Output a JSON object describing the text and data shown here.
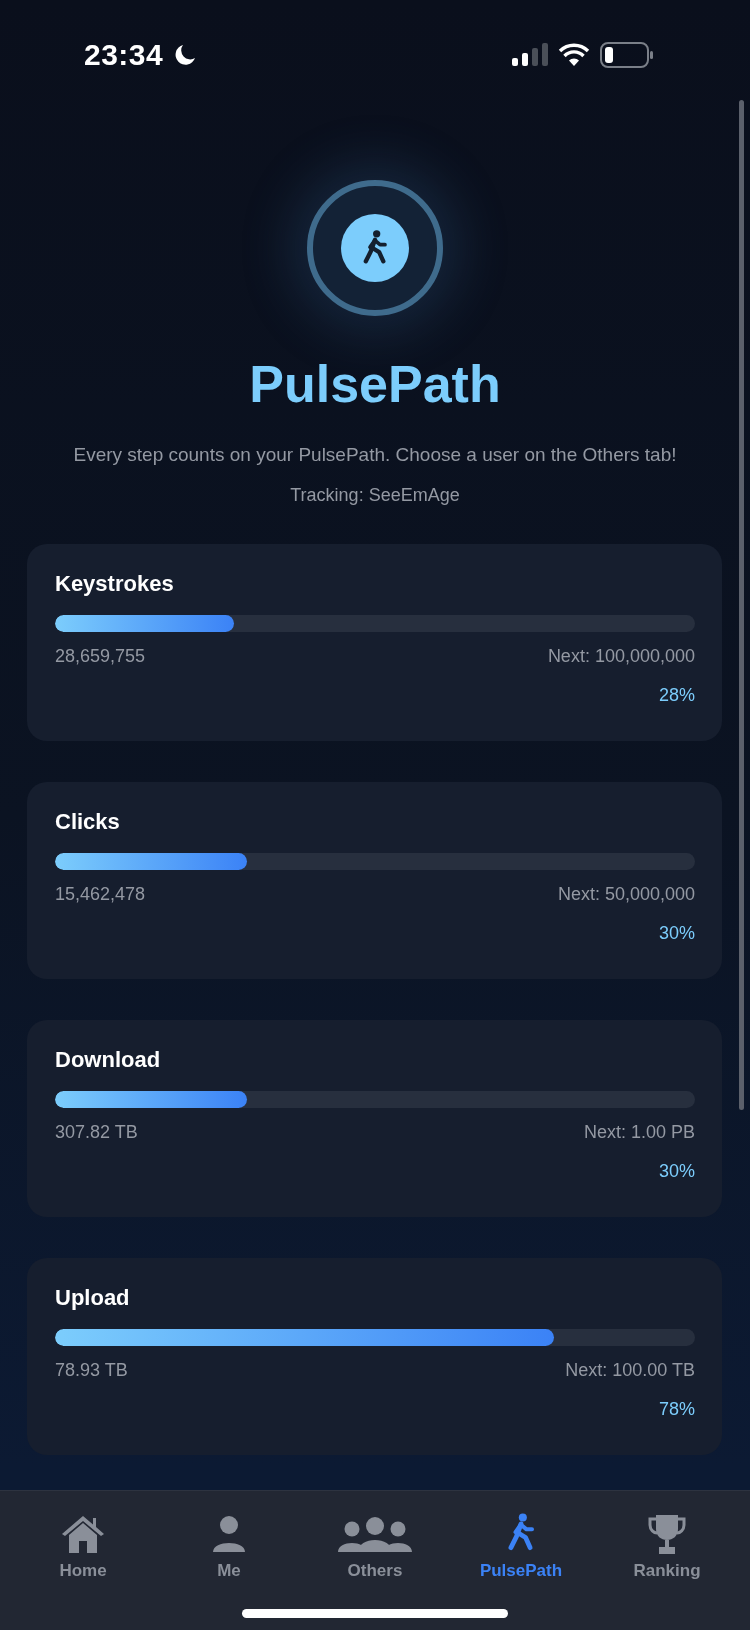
{
  "status_bar": {
    "time": "23:34"
  },
  "hero": {
    "title": "PulsePath",
    "subtitle": "Every step counts on your PulsePath. Choose a user on the Others tab!",
    "tracking": "Tracking: SeeEmAge"
  },
  "metrics": [
    {
      "name": "Keystrokes",
      "level": 0.28,
      "value": "28,659,755",
      "next": "Next: 100,000,000",
      "percent": "28%"
    },
    {
      "name": "Clicks",
      "level": 0.3,
      "value": "15,462,478",
      "next": "Next: 50,000,000",
      "percent": "30%"
    },
    {
      "name": "Download",
      "level": 0.3,
      "value": "307.82 TB",
      "next": "Next: 1.00 PB",
      "percent": "30%"
    },
    {
      "name": "Upload",
      "level": 0.78,
      "value": "78.93 TB",
      "next": "Next: 100.00 TB",
      "percent": "78%"
    }
  ],
  "tab_bar": [
    {
      "kind": "home",
      "label": "Home",
      "selected": false
    },
    {
      "kind": "me",
      "label": "Me",
      "selected": false
    },
    {
      "kind": "others",
      "label": "Others",
      "selected": false
    },
    {
      "kind": "walk",
      "label": "PulsePath",
      "selected": true
    },
    {
      "kind": "ranking",
      "label": "Ranking",
      "selected": false
    }
  ]
}
